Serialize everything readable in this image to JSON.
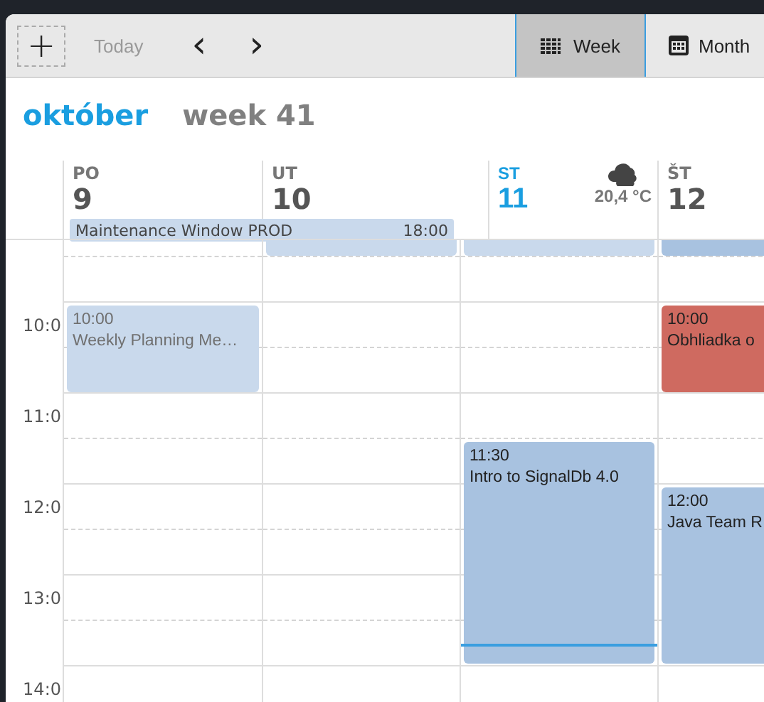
{
  "toolbar": {
    "add_button": "+",
    "today": {
      "label": "Today",
      "disabled": true
    },
    "prev": "‹",
    "next": "›",
    "views": [
      {
        "label": "Week",
        "kind": "week",
        "selected": true
      },
      {
        "label": "Month",
        "kind": "month",
        "selected": false
      }
    ]
  },
  "title": {
    "month": "október",
    "week": "week 41"
  },
  "days": [
    {
      "dow": "PO",
      "date": "9",
      "today": false,
      "all_day": [
        {
          "title": "Maintenance Window PROD",
          "time": "18:00",
          "continues": true
        }
      ],
      "events": [
        {
          "kind": "short",
          "start": "10:00",
          "title": "Weekly Planning Me…",
          "color": "#c9d9ec",
          "past": true
        }
      ]
    },
    {
      "dow": "UT",
      "date": "10",
      "today": false,
      "events": [
        {
          "kind": "partial",
          "color": "#c9d9ec"
        }
      ]
    },
    {
      "dow": "ST",
      "date": "11",
      "today": true,
      "weather": {
        "temperature": "20,4 °C"
      },
      "now_line": true,
      "events": [
        {
          "kind": "partial",
          "color": "#c9d9ec"
        },
        {
          "kind": "long",
          "start": "11:30",
          "title": "Intro to SignalDb 4.0",
          "color": "#a8c2e0",
          "past": false
        }
      ]
    },
    {
      "dow": "ŠT",
      "date": "12",
      "today": false,
      "events": [
        {
          "kind": "partial",
          "color": "#a8c2e0"
        },
        {
          "kind": "short",
          "start": "10:00",
          "title": "Obhliadka o",
          "color": "#cf6a60",
          "past": false
        },
        {
          "kind": "long",
          "start": "12:00",
          "title": "Java Team R",
          "color": "#a8c2e0",
          "past": false
        }
      ]
    }
  ],
  "hours": [
    "10:0",
    "11:0",
    "12:0",
    "13:0",
    "14:0"
  ]
}
